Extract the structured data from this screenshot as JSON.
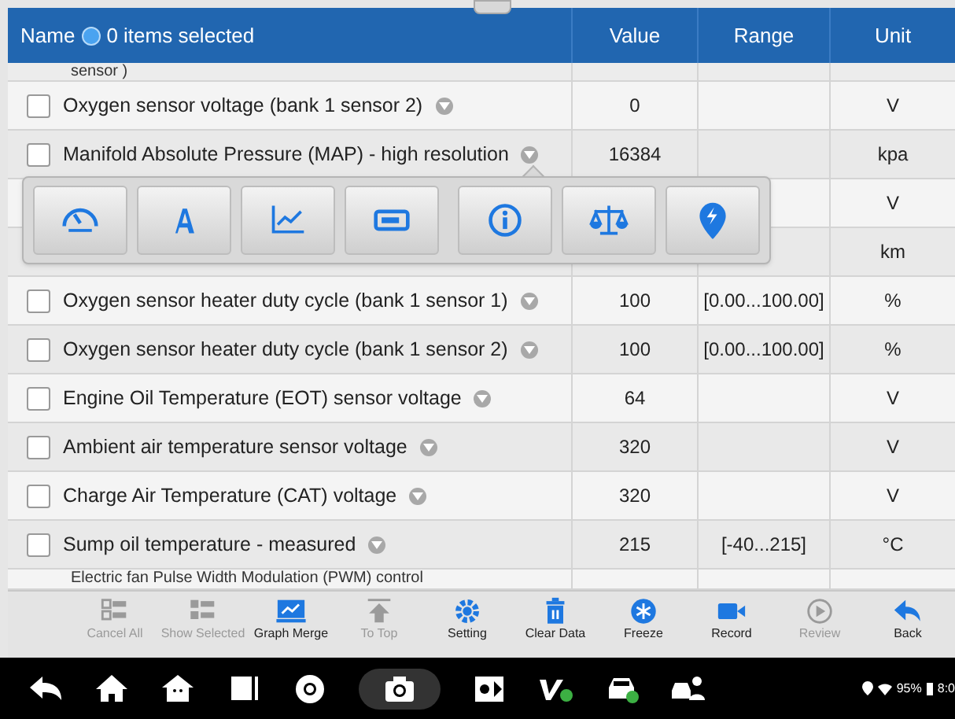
{
  "header": {
    "name": "Name",
    "selection": "0 items selected",
    "columns": [
      "Value",
      "Range",
      "Unit"
    ]
  },
  "top_partial": "sensor )",
  "rows": [
    {
      "name": "Oxygen sensor voltage (bank 1 sensor 2)",
      "value": "0",
      "range": "",
      "unit": "V",
      "selected": false
    },
    {
      "name": "Manifold Absolute Pressure (MAP) - high resolution",
      "value": "16384",
      "range": "",
      "unit": "kpa",
      "selected": false
    },
    {
      "name": "",
      "value": "",
      "range": "",
      "unit": "V"
    },
    {
      "name": "",
      "value": "",
      "range": "",
      "unit": "km"
    },
    {
      "name": "Oxygen sensor heater duty cycle (bank 1 sensor 1)",
      "value": "100",
      "range": "[0.00...100.00]",
      "unit": "%",
      "selected": false
    },
    {
      "name": "Oxygen sensor heater duty cycle (bank 1 sensor 2)",
      "value": "100",
      "range": "[0.00...100.00]",
      "unit": "%",
      "selected": false
    },
    {
      "name": "Engine Oil Temperature (EOT) sensor voltage",
      "value": "64",
      "range": "",
      "unit": "V",
      "selected": false
    },
    {
      "name": "Ambient air temperature sensor voltage",
      "value": "320",
      "range": "",
      "unit": "V",
      "selected": false
    },
    {
      "name": "Charge Air Temperature (CAT) voltage",
      "value": "320",
      "range": "",
      "unit": "V",
      "selected": false
    },
    {
      "name": "Sump oil temperature - measured",
      "value": "215",
      "range": "[-40...215]",
      "unit": "°C",
      "selected": false
    }
  ],
  "bottom_partial": "Electric fan Pulse Width Modulation (PWM) control",
  "popup": [
    {
      "kind": "gauge"
    },
    {
      "kind": "text"
    },
    {
      "kind": "graph"
    },
    {
      "kind": "bar"
    },
    {
      "kind": "info"
    },
    {
      "kind": "scale"
    },
    {
      "kind": "pin"
    }
  ],
  "toolbar": [
    {
      "label": "Cancel All",
      "kind": "cancel",
      "disabled": true
    },
    {
      "label": "Show Selected",
      "kind": "show",
      "disabled": true
    },
    {
      "label": "Graph Merge",
      "kind": "merge",
      "disabled": false
    },
    {
      "label": "To Top",
      "kind": "top",
      "disabled": true
    },
    {
      "label": "Setting",
      "kind": "setting",
      "disabled": false
    },
    {
      "label": "Clear Data",
      "kind": "clear",
      "disabled": false
    },
    {
      "label": "Freeze",
      "kind": "freeze",
      "disabled": false
    },
    {
      "label": "Record",
      "kind": "record",
      "disabled": false
    },
    {
      "label": "Review",
      "kind": "review",
      "disabled": true
    },
    {
      "label": "Back",
      "kind": "back",
      "disabled": false
    }
  ],
  "status": {
    "battery": "95%",
    "time": "8:0"
  }
}
